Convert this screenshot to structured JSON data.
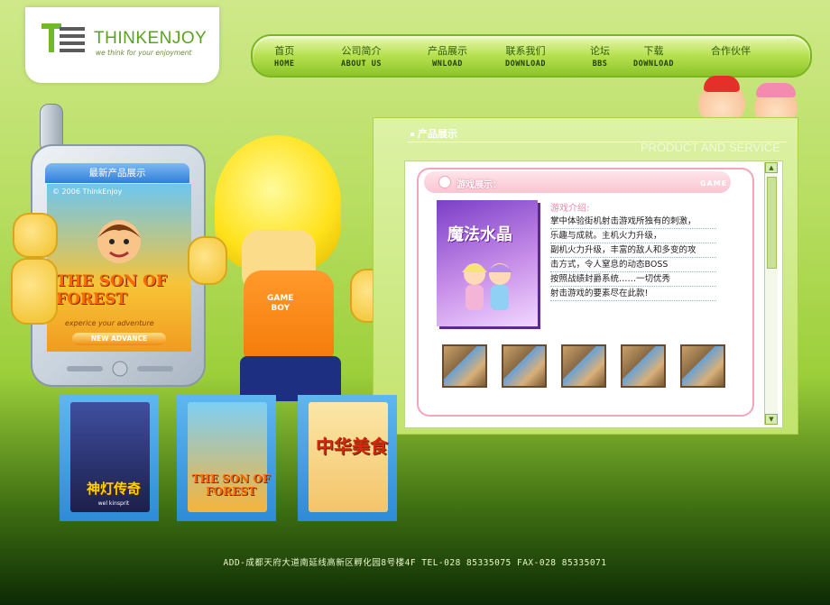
{
  "logo": {
    "name": "THINKENJOY",
    "slogan": "we think for your enjoyment",
    "mark": "TE"
  },
  "nav": [
    {
      "cn": "首页",
      "en": "HOME"
    },
    {
      "cn": "公司简介",
      "en": "ABOUT US"
    },
    {
      "cn": "产品展示",
      "en": "WNLOAD"
    },
    {
      "cn": "联系我们",
      "en": "DOWNLOAD"
    },
    {
      "cn": "论坛",
      "en": "BBS"
    },
    {
      "cn": "下载",
      "en": "DOWNLOAD"
    },
    {
      "cn": "合作伙伴",
      "en": ""
    }
  ],
  "phone": {
    "header": "最新产品展示",
    "copyright": "© 2006 ThinkEnjoy",
    "game_title": "THE SON OF FOREST",
    "game_sub": "experice your adventure",
    "button": "NEW ADVANCE"
  },
  "character": {
    "shirt_text": "GAME\nBOY"
  },
  "panel": {
    "title": "产品展示",
    "subtitle_en": "PRODUCT AND SERVICE",
    "section_label": "游戏展示：",
    "section_tag": "GAME",
    "cover_title": "魔法水晶",
    "intro_head": "游戏介绍:",
    "intro_lines": [
      "掌中体验街机射击游戏所独有的刺激，",
      "乐趣与成就。主机火力升级，",
      "副机火力升级，丰富的敌人和多变的攻",
      "击方式，令人窒息的动态BOSS",
      "按照战绩封爵系统……一切优秀",
      "射击游戏的要素尽在此款!"
    ],
    "thumb_count": 5
  },
  "boxes": [
    {
      "title": "神灯传奇",
      "sub": "wel kinsprit",
      "color": "#2a2d5e"
    },
    {
      "title": "THE SON OF FOREST",
      "sub": "",
      "color": "#f4a52a"
    },
    {
      "title": "中华美食",
      "sub": "",
      "color": "#f2d27a"
    }
  ],
  "footer": "ADD-成都天府大道南延线高新区孵化园8号楼4F   TEL-028 85335075   FAX-028 85335071"
}
